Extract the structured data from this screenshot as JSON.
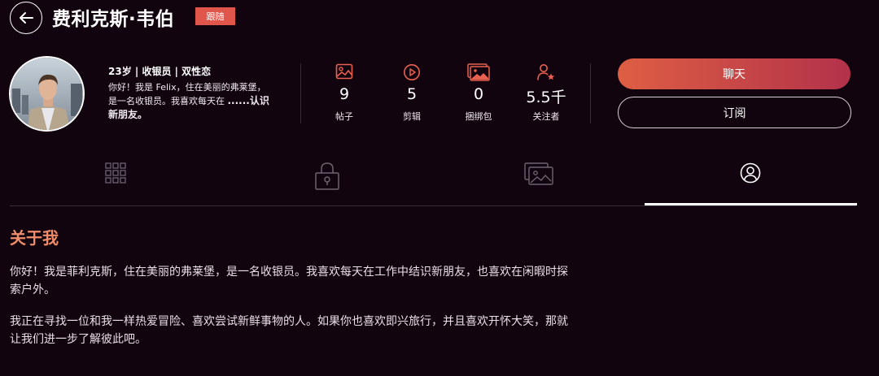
{
  "header": {
    "title": "费利克斯·韦伯",
    "follow_label": "跟随"
  },
  "profile": {
    "headline": "23岁 | 收银员 | 双性恋",
    "bio_line1": "你好！我是 Felix，住在美丽的弗莱堡，",
    "bio_line2": "是一名收银员。我喜欢每天在 ",
    "bio_bold": "......认识",
    "bio_bold2": "新朋友。"
  },
  "stats": [
    {
      "icon": "image-icon",
      "value": "9",
      "label": "帖子"
    },
    {
      "icon": "play-circle-icon",
      "value": "5",
      "label": "剪辑"
    },
    {
      "icon": "gallery-bundle-icon",
      "value": "0",
      "label": "捆绑包"
    },
    {
      "icon": "user-star-icon",
      "value": "5.5千",
      "label": "关注者"
    }
  ],
  "actions": {
    "chat_label": "聊天",
    "subscribe_label": "订阅"
  },
  "tabs": [
    {
      "icon": "grid-icon",
      "active": false
    },
    {
      "icon": "lock-icon",
      "active": false
    },
    {
      "icon": "gallery-icon",
      "active": false
    },
    {
      "icon": "profile-icon",
      "active": true
    }
  ],
  "about": {
    "title": "关于我",
    "p1_line1": "你好！我是菲利克斯，住在美丽的弗莱堡，是一名收银员。我喜欢每天在工作中结识新朋友，也喜欢在闲暇时探",
    "p1_line2": "索户外。",
    "p2_line1": "我正在寻找一位和我一样热爱冒险、喜欢尝试新鲜事物的人。如果你也喜欢即兴旅行，并且喜欢开怀大笑，那就",
    "p2_line2": "让我们进一步了解彼此吧。"
  },
  "colors": {
    "background": "#12040f",
    "accent": "#e1564a",
    "about_title": "#f08c6a"
  }
}
